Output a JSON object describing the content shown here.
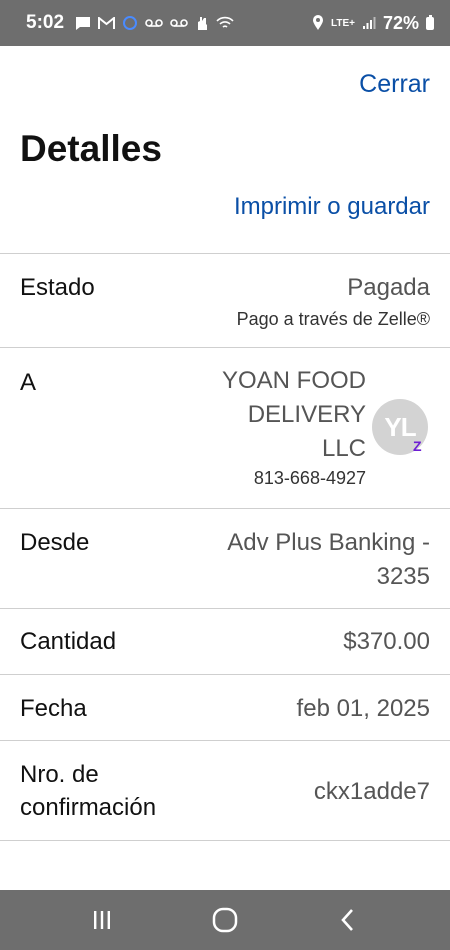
{
  "status_bar": {
    "time": "5:02",
    "network": "LTE+",
    "battery": "72%"
  },
  "header": {
    "close_label": "Cerrar",
    "title": "Detalles",
    "print_label": "Imprimir o guardar"
  },
  "details": {
    "status": {
      "label": "Estado",
      "value": "Pagada",
      "note": "Pago a través de Zelle®"
    },
    "to": {
      "label": "A",
      "name_lines": [
        "YOAN FOOD",
        "DELIVERY",
        "LLC"
      ],
      "phone": "813-668-4927",
      "avatar_initials": "YL",
      "badge": "Z"
    },
    "from": {
      "label": "Desde",
      "value_lines": [
        "Adv Plus Banking -",
        "3235"
      ]
    },
    "amount": {
      "label": "Cantidad",
      "value": "$370.00"
    },
    "date": {
      "label": "Fecha",
      "value": "feb 01, 2025"
    },
    "confirmation": {
      "label_lines": [
        "Nro. de",
        "confirmación"
      ],
      "value": "ckx1adde7"
    }
  },
  "colors": {
    "link": "#0a4fa6",
    "zelle": "#6d1ed4",
    "system_bar": "#6e6e6e"
  }
}
